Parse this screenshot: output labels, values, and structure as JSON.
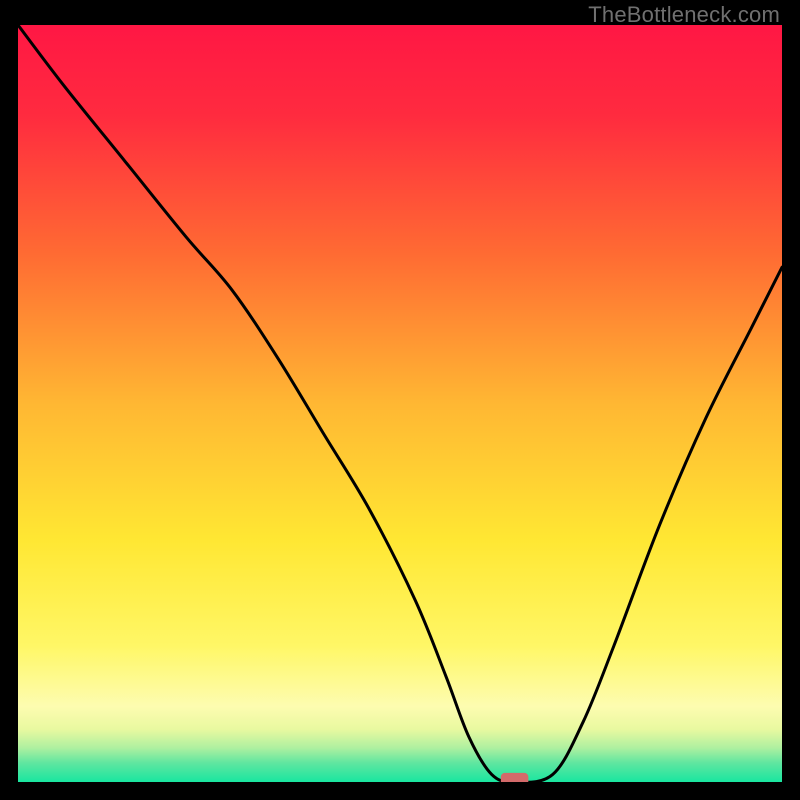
{
  "watermark": "TheBottleneck.com",
  "chart_data": {
    "type": "line",
    "title": "",
    "xlabel": "",
    "ylabel": "",
    "xlim": [
      0,
      100
    ],
    "ylim": [
      0,
      100
    ],
    "axes_visible": false,
    "grid": false,
    "background": {
      "type": "vertical-gradient",
      "stops": [
        {
          "pos": 0.0,
          "color": "#ff1744"
        },
        {
          "pos": 0.12,
          "color": "#ff2b3f"
        },
        {
          "pos": 0.3,
          "color": "#ff6a33"
        },
        {
          "pos": 0.5,
          "color": "#ffb733"
        },
        {
          "pos": 0.68,
          "color": "#ffe733"
        },
        {
          "pos": 0.82,
          "color": "#fff766"
        },
        {
          "pos": 0.9,
          "color": "#fdfcb0"
        },
        {
          "pos": 0.93,
          "color": "#e9f9a0"
        },
        {
          "pos": 0.955,
          "color": "#aef0a0"
        },
        {
          "pos": 0.975,
          "color": "#5fe6a0"
        },
        {
          "pos": 1.0,
          "color": "#19e6a0"
        }
      ]
    },
    "series": [
      {
        "name": "bottleneck-curve",
        "color": "#000000",
        "x": [
          0,
          6,
          14,
          22,
          28,
          34,
          40,
          46,
          52,
          56,
          59,
          62,
          65,
          70,
          74,
          78,
          84,
          90,
          96,
          100
        ],
        "y": [
          100,
          92,
          82,
          72,
          65,
          56,
          46,
          36,
          24,
          14,
          6,
          1,
          0,
          1,
          8,
          18,
          34,
          48,
          60,
          68
        ]
      }
    ],
    "marker": {
      "name": "optimal-point",
      "x": 65,
      "y": 0.4,
      "shape": "rounded-rect",
      "width": 3.6,
      "height": 1.6,
      "color": "#d36a6a"
    }
  }
}
